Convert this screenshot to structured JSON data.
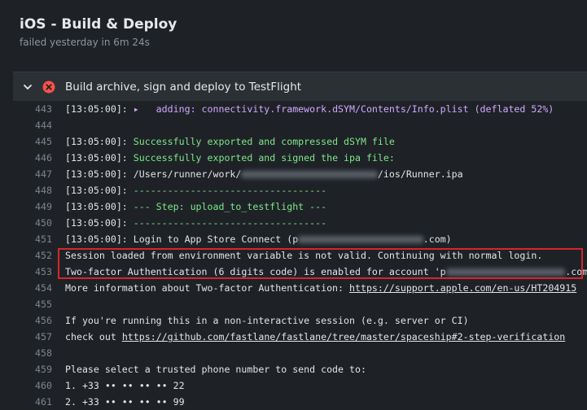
{
  "header": {
    "title": "iOS - Build & Deploy",
    "subtitle": "failed yesterday in 6m 24s"
  },
  "step": {
    "title": "Build archive, sign and deploy to TestFlight",
    "status": "failed",
    "status_color": "#f85149"
  },
  "log": {
    "lines": [
      {
        "n": "443",
        "segments": [
          {
            "t": "[13:05:00]: ",
            "c": ""
          },
          {
            "t": "▸   adding: connectivity.framework.dSYM/Contents/Info.plist (deflated 52%)",
            "c": "purple"
          }
        ]
      },
      {
        "n": "444",
        "segments": []
      },
      {
        "n": "445",
        "segments": [
          {
            "t": "[13:05:00]: ",
            "c": ""
          },
          {
            "t": "Successfully exported and compressed dSYM file",
            "c": "green"
          }
        ]
      },
      {
        "n": "446",
        "segments": [
          {
            "t": "[13:05:00]: ",
            "c": ""
          },
          {
            "t": "Successfully exported and signed the ipa file:",
            "c": "green"
          }
        ]
      },
      {
        "n": "447",
        "segments": [
          {
            "t": "[13:05:00]: /Users/runner/work/",
            "c": ""
          },
          {
            "t": "                        ",
            "c": "blur"
          },
          {
            "t": "/ios/Runner.ipa",
            "c": ""
          }
        ]
      },
      {
        "n": "448",
        "segments": [
          {
            "t": "[13:05:00]: ",
            "c": ""
          },
          {
            "t": "----------------------------------",
            "c": "green"
          }
        ]
      },
      {
        "n": "449",
        "segments": [
          {
            "t": "[13:05:00]: ",
            "c": ""
          },
          {
            "t": "--- Step: upload_to_testflight ---",
            "c": "green"
          }
        ]
      },
      {
        "n": "450",
        "segments": [
          {
            "t": "[13:05:00]: ",
            "c": ""
          },
          {
            "t": "----------------------------------",
            "c": "green"
          }
        ]
      },
      {
        "n": "451",
        "segments": [
          {
            "t": "[13:05:00]: Login to App Store Connect (p",
            "c": ""
          },
          {
            "t": "                      ",
            "c": "blur"
          },
          {
            "t": ".com)",
            "c": ""
          }
        ]
      },
      {
        "n": "452",
        "segments": [
          {
            "t": "Session loaded from environment variable is not valid. Continuing with normal login.",
            "c": ""
          }
        ]
      },
      {
        "n": "453",
        "segments": [
          {
            "t": "Two-factor Authentication (6 digits code) is enabled for account 'p",
            "c": ""
          },
          {
            "t": "                     ",
            "c": "blur"
          },
          {
            "t": ".com'",
            "c": ""
          }
        ]
      },
      {
        "n": "454",
        "segments": [
          {
            "t": "More information about Two-factor Authentication: ",
            "c": ""
          },
          {
            "t": "https://support.apple.com/en-us/HT204915",
            "c": "link"
          }
        ]
      },
      {
        "n": "455",
        "segments": []
      },
      {
        "n": "456",
        "segments": [
          {
            "t": "If you're running this in a non-interactive session (e.g. server or CI)",
            "c": ""
          }
        ]
      },
      {
        "n": "457",
        "segments": [
          {
            "t": "check out ",
            "c": ""
          },
          {
            "t": "https://github.com/fastlane/fastlane/tree/master/spaceship#2-step-verification",
            "c": "link"
          }
        ]
      },
      {
        "n": "458",
        "segments": []
      },
      {
        "n": "459",
        "segments": [
          {
            "t": "Please select a trusted phone number to send code to:",
            "c": ""
          }
        ]
      },
      {
        "n": "460",
        "segments": [
          {
            "t": "1. +33 •• •• •• •• 22",
            "c": ""
          }
        ]
      },
      {
        "n": "461",
        "segments": [
          {
            "t": "2. +33 •• •• •• •• 99",
            "c": ""
          }
        ]
      }
    ]
  }
}
